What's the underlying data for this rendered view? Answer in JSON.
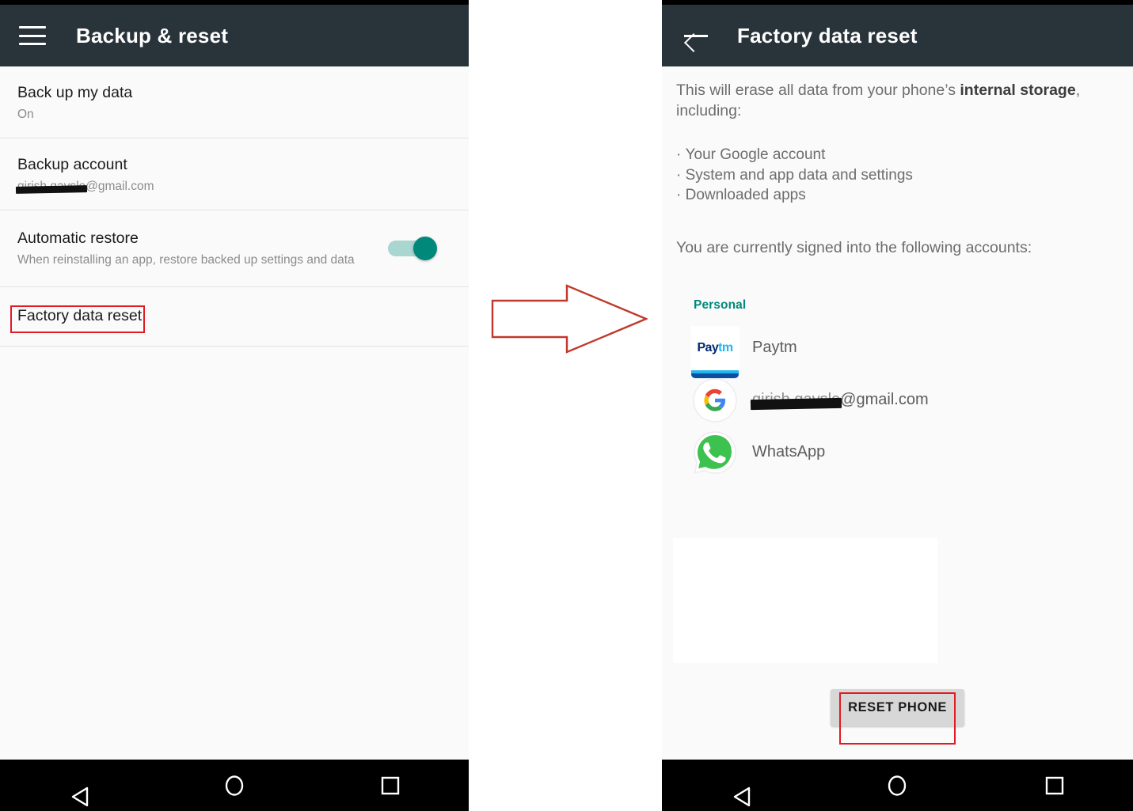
{
  "colors": {
    "toolbar": "#29333a",
    "accent_teal": "#00897b",
    "highlight_red": "#e01b24",
    "background": "#fafafa",
    "navbar": "#000000"
  },
  "left_phone": {
    "toolbar": {
      "menu_icon": "hamburger-icon",
      "title": "Backup & reset"
    },
    "rows": [
      {
        "title": "Back up my data",
        "subtitle": "On"
      },
      {
        "title": "Backup account",
        "subtitle_redacted": "girish gaysle",
        "subtitle_suffix": "@gmail.com"
      },
      {
        "title": "Automatic restore",
        "subtitle": "When reinstalling an app, restore backed up settings and data",
        "toggle": "on"
      },
      {
        "title": "Factory data reset",
        "highlighted": true
      }
    ],
    "navbar": {
      "back": "back-triangle-icon",
      "home": "home-circle-icon",
      "recents": "recents-square-icon"
    }
  },
  "connector": {
    "arrow_icon": "right-arrow-icon",
    "arrow_color": "#c0392b"
  },
  "right_phone": {
    "toolbar": {
      "back_icon": "back-arrow-icon",
      "title": "Factory data reset"
    },
    "body": {
      "intro_prefix": "This will erase all data from your phone’s ",
      "intro_bold": "internal storage",
      "intro_suffix": ", including:",
      "bullets": [
        "Your Google account",
        "System and app data and settings",
        "Downloaded apps"
      ],
      "signed_in_text": "You are currently signed into the following accounts:",
      "account_group_label": "Personal",
      "accounts": [
        {
          "icon": "paytm-icon",
          "label": "Paytm"
        },
        {
          "icon": "google-icon",
          "label_redacted": "girish gaysle",
          "label_suffix": "@gmail.com"
        },
        {
          "icon": "whatsapp-icon",
          "label": "WhatsApp"
        }
      ],
      "reset_button_label": "RESET PHONE"
    },
    "navbar": {
      "back": "back-triangle-icon",
      "home": "home-circle-icon",
      "recents": "recents-square-icon"
    }
  }
}
